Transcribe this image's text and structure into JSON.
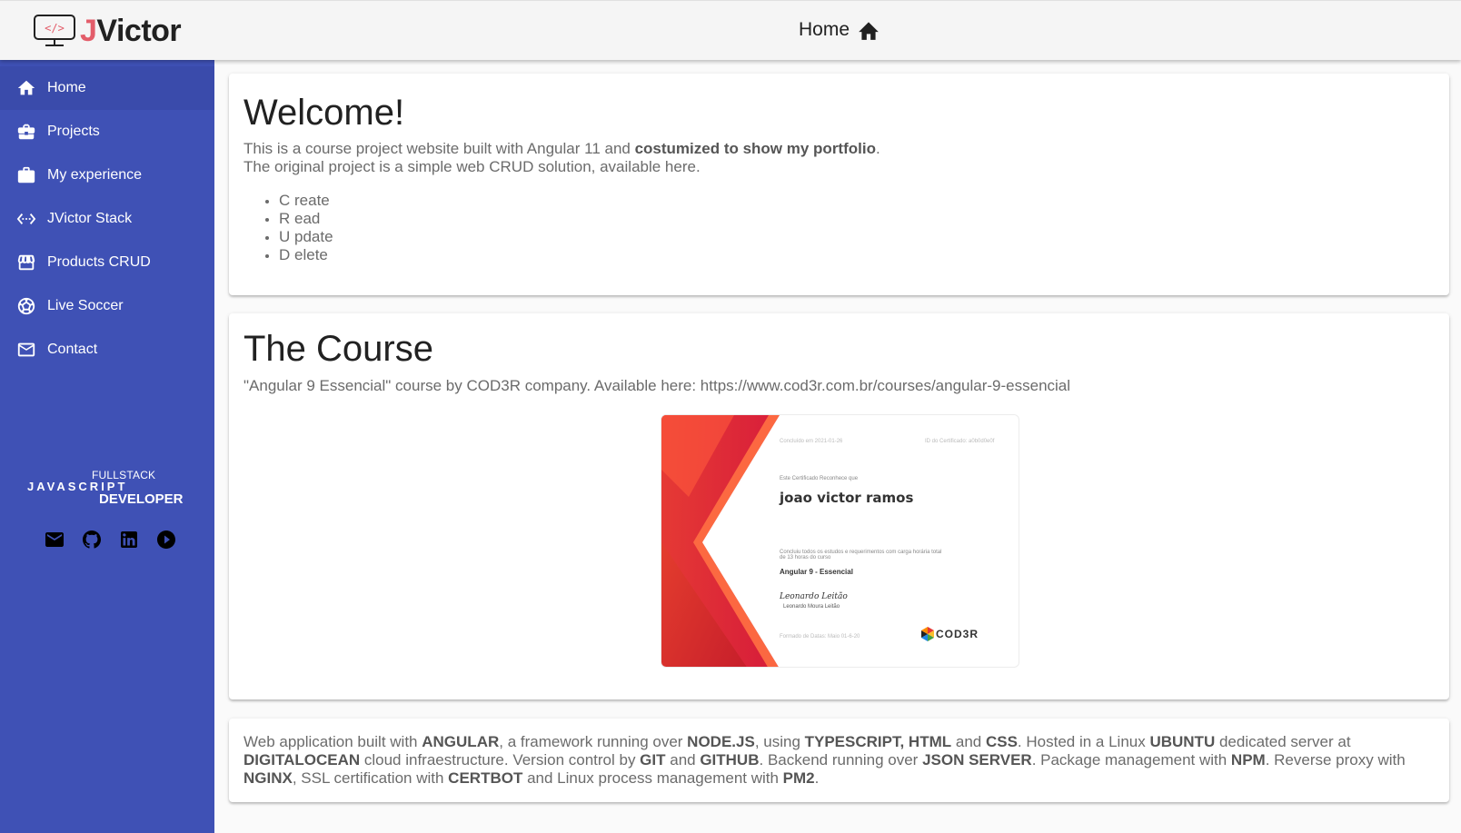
{
  "header": {
    "logo_j": "J",
    "logo_rest": "Victor",
    "title": "Home"
  },
  "sidebar": {
    "items": [
      {
        "label": "Home",
        "icon": "home-icon"
      },
      {
        "label": "Projects",
        "icon": "briefcase-icon"
      },
      {
        "label": "My experience",
        "icon": "briefcase-icon"
      },
      {
        "label": "JVictor Stack",
        "icon": "code-icon"
      },
      {
        "label": "Products CRUD",
        "icon": "store-icon"
      },
      {
        "label": "Live Soccer",
        "icon": "soccer-ball-icon"
      },
      {
        "label": "Contact",
        "icon": "mail-icon"
      }
    ],
    "badge": {
      "top": "FULLSTACK",
      "middle": "JAVASCRIPT",
      "bottom": "DEVELOPER"
    },
    "social": [
      "mail-icon",
      "github-icon",
      "linkedin-icon",
      "youtube-icon"
    ]
  },
  "welcome": {
    "title": "Welcome!",
    "line1_a": "This is a course project website built with Angular 11 and ",
    "line1_b": "costumized to show my portfolio",
    "line1_c": ".",
    "line2": "The original project is a simple web CRUD solution, available here.",
    "crud": [
      {
        "letter": "C",
        "rest": " reate"
      },
      {
        "letter": "R",
        "rest": " ead"
      },
      {
        "letter": "U",
        "rest": " pdate"
      },
      {
        "letter": "D",
        "rest": " elete"
      }
    ]
  },
  "course": {
    "title": "The Course",
    "text": "\"Angular 9 Essencial\" course by COD3R company. Available here: https://www.cod3r.com.br/courses/angular-9-essencial",
    "certificate": {
      "small_top_left": "Concluído em 2021-01-26",
      "small_top_right": "ID do Certificado: a0b0d0e0f",
      "recognizes": "Este Certificado Reconhece que",
      "name": "joao victor ramos",
      "concluded": "Concluiu todos os estudos e requerimentos com carga horária total de 13 horas do curso",
      "course": "Angular 9 - Essencial",
      "signature": "Leonardo Leitão",
      "signer": "Leonardo Moura Leitão",
      "footer": "Formado de Datas: Maio 01-6-20",
      "brand": "COD3R"
    }
  },
  "footer_text": {
    "parts": [
      [
        "Web application built with ",
        false
      ],
      [
        "ANGULAR",
        true
      ],
      [
        ", a framework running over ",
        false
      ],
      [
        "NODE.JS",
        true
      ],
      [
        ", using ",
        false
      ],
      [
        "TYPESCRIPT, HTML",
        true
      ],
      [
        " and ",
        false
      ],
      [
        "CSS",
        true
      ],
      [
        ". Hosted in a Linux ",
        false
      ],
      [
        "UBUNTU",
        true
      ],
      [
        " dedicated server at ",
        false
      ],
      [
        "DIGITALOCEAN",
        true
      ],
      [
        " cloud infraestructure. Version control by ",
        false
      ],
      [
        "GIT",
        true
      ],
      [
        " and ",
        false
      ],
      [
        "GITHUB",
        true
      ],
      [
        ". Backend running over ",
        false
      ],
      [
        "JSON SERVER",
        true
      ],
      [
        ". Package management with ",
        false
      ],
      [
        "NPM",
        true
      ],
      [
        ". Reverse proxy with ",
        false
      ],
      [
        "NGINX",
        true
      ],
      [
        ", SSL certification with ",
        false
      ],
      [
        "CERTBOT",
        true
      ],
      [
        " and Linux process management with ",
        false
      ],
      [
        "PM2",
        true
      ],
      [
        ".",
        false
      ]
    ]
  },
  "colors": {
    "primary": "#3f51b5",
    "logo_accent": "#e35d6a"
  }
}
